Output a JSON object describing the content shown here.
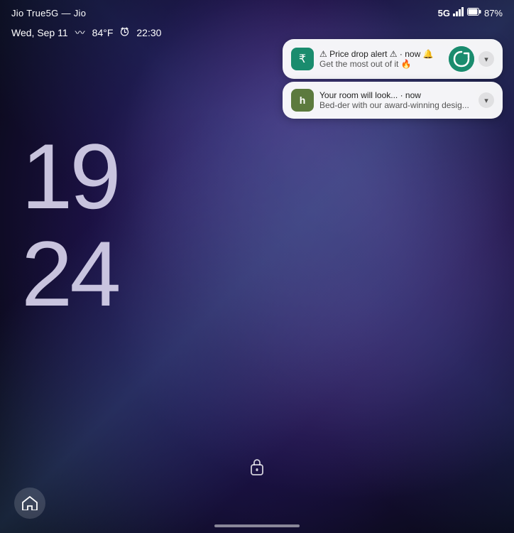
{
  "statusBar": {
    "carrier": "Jio True5G — Jio",
    "network": "5G",
    "battery": "87%",
    "batteryIcon": "🔋"
  },
  "dateBar": {
    "date": "Wed, Sep 11",
    "weather": "84°F",
    "alarm": "22:30"
  },
  "clock": {
    "hour": "19",
    "minute": "24"
  },
  "notifications": [
    {
      "id": "notification-1",
      "appIcon": "₹",
      "appIconStyle": "cashify",
      "title": "⚠ Price drop alert ⚠ · now 🔔",
      "body": "Get the most out of it 🔥",
      "hasLargeIcon": true,
      "largeIconSymbol": "✓",
      "time": "now"
    },
    {
      "id": "notification-2",
      "appIcon": "H",
      "appIconStyle": "houzz",
      "title": "Your room will look... · now",
      "body": "Bed-der with our award-winning desig...",
      "hasLargeIcon": false,
      "time": "now"
    }
  ],
  "unlockIcon": "🔓",
  "homeButton": "⌂",
  "colors": {
    "wallpaperPrimary": "#3a2a6e",
    "wallpaperAccent": "#6b4fa0",
    "notifBackground": "rgba(255,255,255,0.95)"
  }
}
